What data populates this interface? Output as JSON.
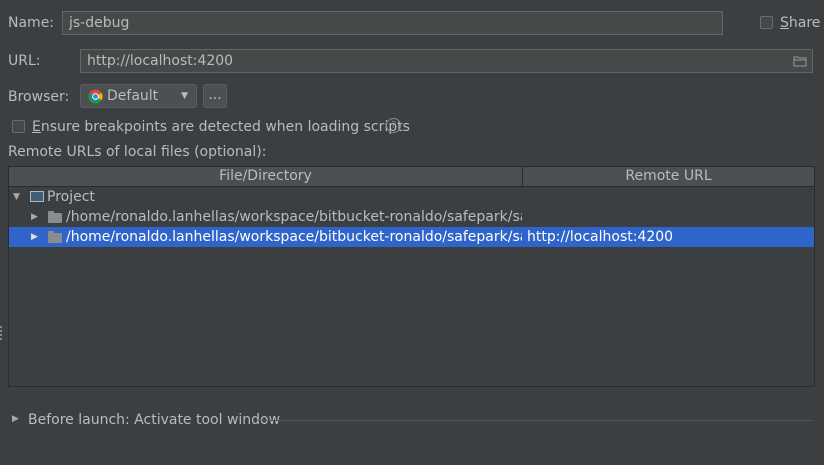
{
  "name": {
    "label": "Name:",
    "value": "js-debug"
  },
  "share": {
    "label": "Share",
    "checked": false
  },
  "url": {
    "label": "URL:",
    "value": "http://localhost:4200"
  },
  "browser": {
    "label": "Browser:",
    "value": "Default",
    "more_label": "...",
    "icon": "chrome-icon"
  },
  "ensure_breakpoints": {
    "label": "Ensure breakpoints are detected when loading scripts",
    "checked": false
  },
  "remote_urls": {
    "label": "Remote URLs of local files (optional):",
    "columns": [
      "File/Directory",
      "Remote URL"
    ],
    "root": {
      "label": "Project",
      "expanded": true
    },
    "rows": [
      {
        "path": "/home/ronaldo.lanhellas/workspace/bitbucket-ronaldo/safepark/safepa",
        "remote": "",
        "selected": false
      },
      {
        "path": "/home/ronaldo.lanhellas/workspace/bitbucket-ronaldo/safepark/safepa",
        "remote": "http://localhost:4200",
        "selected": true
      }
    ]
  },
  "before_launch": {
    "label": "Before launch: Activate tool window",
    "expanded": false
  },
  "colors": {
    "background": "#3c3f41",
    "selection": "#2f65ca"
  }
}
